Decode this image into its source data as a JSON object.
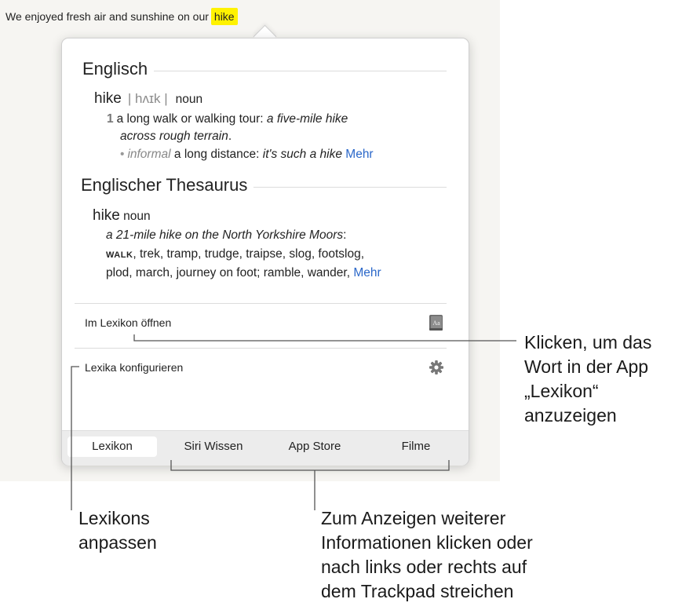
{
  "source_text": {
    "before": "We enjoyed fresh air and sunshine on our",
    "highlighted": "hike"
  },
  "dictionary": {
    "heading": "Englisch",
    "headword": "hike",
    "pronunciation": "| hʌɪk |",
    "pos": "noun",
    "sense_number": "1",
    "sense_def": "a long walk or walking tour:",
    "sense_example_1": "a five-mile hike",
    "sense_example_2": "across rough terrain",
    "sense_example_end": ".",
    "sub_bullet": "•",
    "sub_register": "informal",
    "sub_def": "a long distance:",
    "sub_example": "it's such a hike",
    "more_label": "Mehr"
  },
  "thesaurus": {
    "heading": "Englischer Thesaurus",
    "headword": "hike",
    "pos": "noun",
    "example": "a 21-mile hike on the North Yorkshire Moors",
    "example_end": ":",
    "core_word": "walk",
    "synonyms_1": ", trek, tramp, trudge, traipse, slog, footslog,",
    "synonyms_2": "plod, march, journey on foot; ramble, wander,",
    "more_label": "Mehr"
  },
  "actions": {
    "open_in_dictionary": "Im Lexikon öffnen",
    "configure_dictionaries": "Lexika konfigurieren"
  },
  "tabs": [
    {
      "label": "Lexikon",
      "active": true
    },
    {
      "label": "Siri Wissen",
      "active": false
    },
    {
      "label": "App Store",
      "active": false
    },
    {
      "label": "Filme",
      "active": false
    }
  ],
  "callouts": {
    "open_app": [
      "Klicken, um das",
      "Wort in der App",
      "„Lexikon“",
      "anzuzeigen"
    ],
    "customize": [
      "Lexikons",
      "anpassen"
    ],
    "swipe": [
      "Zum Anzeigen weiterer",
      "Informationen klicken oder",
      "nach links oder rechts auf",
      "dem Trackpad streichen"
    ]
  },
  "colors": {
    "highlight": "#fff200",
    "link": "#2a67c9"
  },
  "icons": {
    "open": "book-icon",
    "configure": "gear-icon"
  }
}
